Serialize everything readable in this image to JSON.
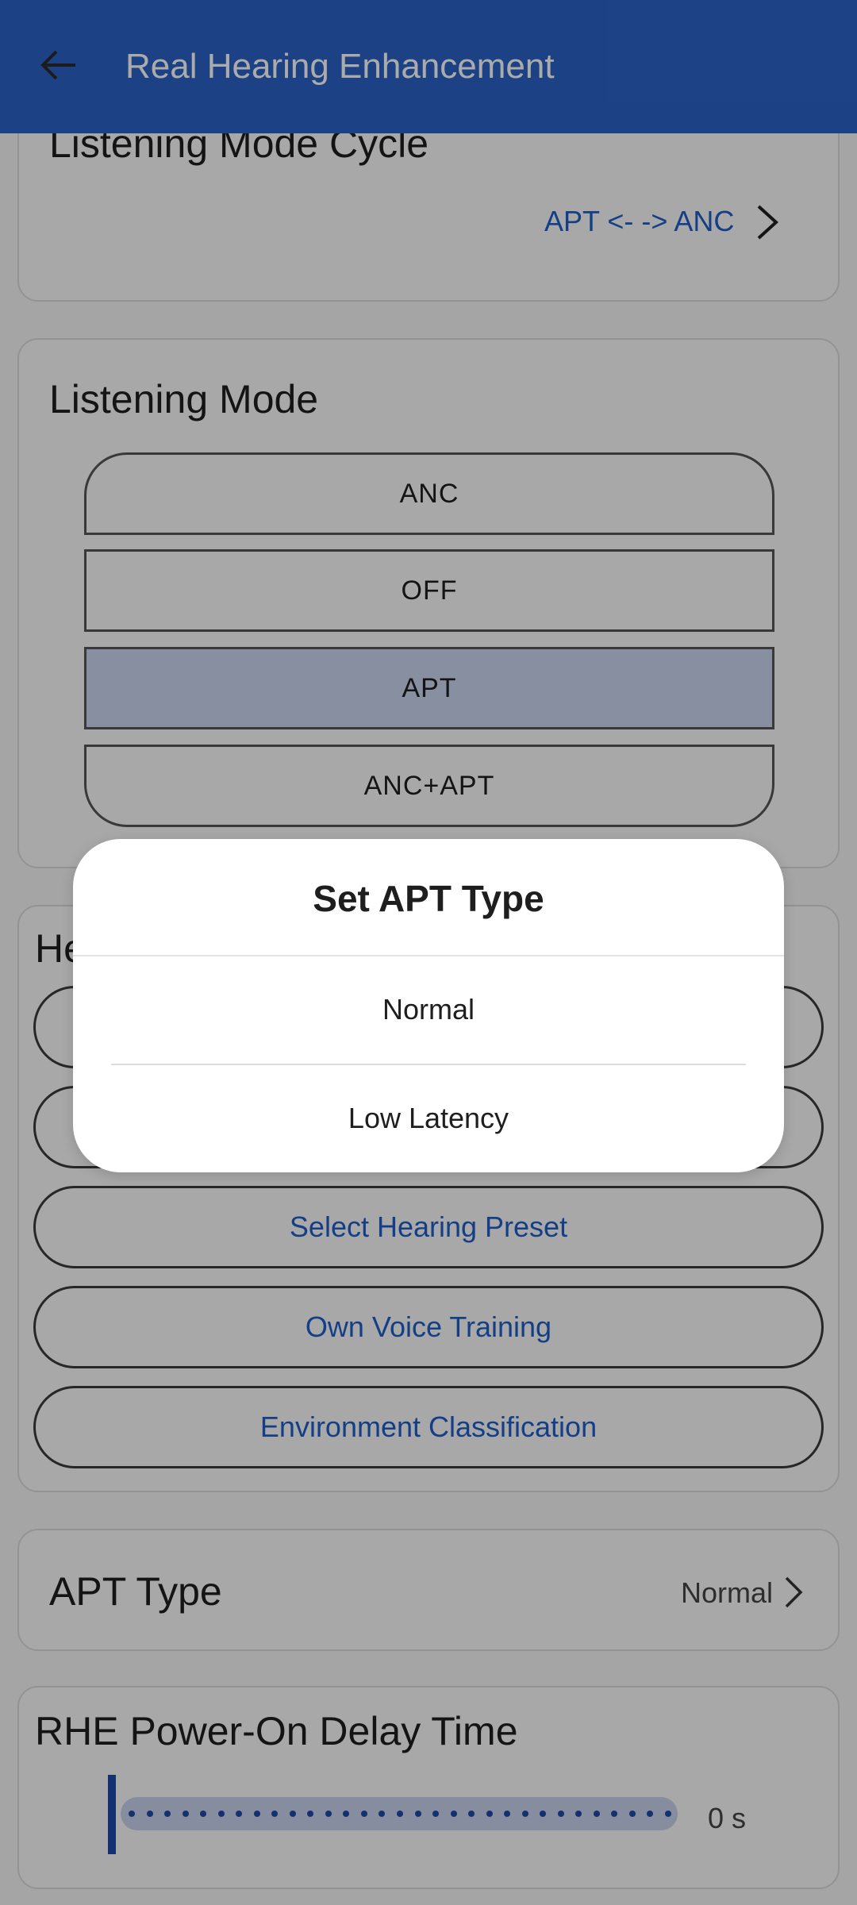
{
  "app_bar": {
    "title": "Real Hearing Enhancement",
    "back_icon": "arrow-left-icon"
  },
  "listening_mode_cycle": {
    "title": "Listening Mode Cycle",
    "value": "APT <- -> ANC"
  },
  "listening_mode": {
    "title": "Listening Mode",
    "options": [
      "ANC",
      "OFF",
      "APT",
      "ANC+APT"
    ],
    "selected": "APT"
  },
  "hearing_section": {
    "title_partial": "He",
    "buttons": [
      "Select Hearing Preset",
      "Own Voice Training",
      "Environment Classification"
    ]
  },
  "apt_type": {
    "title": "APT Type",
    "value": "Normal"
  },
  "rhe_delay": {
    "title": "RHE Power-On Delay Time",
    "value": "0 s",
    "level": 0
  },
  "dialog": {
    "title": "Set APT Type",
    "options": [
      "Normal",
      "Low Latency"
    ]
  },
  "colors": {
    "app_bar": "#2b63c6",
    "accent_text": "#1f5fc8",
    "selected_mode": "#c9d6f0",
    "slider": "#1d49a8"
  }
}
